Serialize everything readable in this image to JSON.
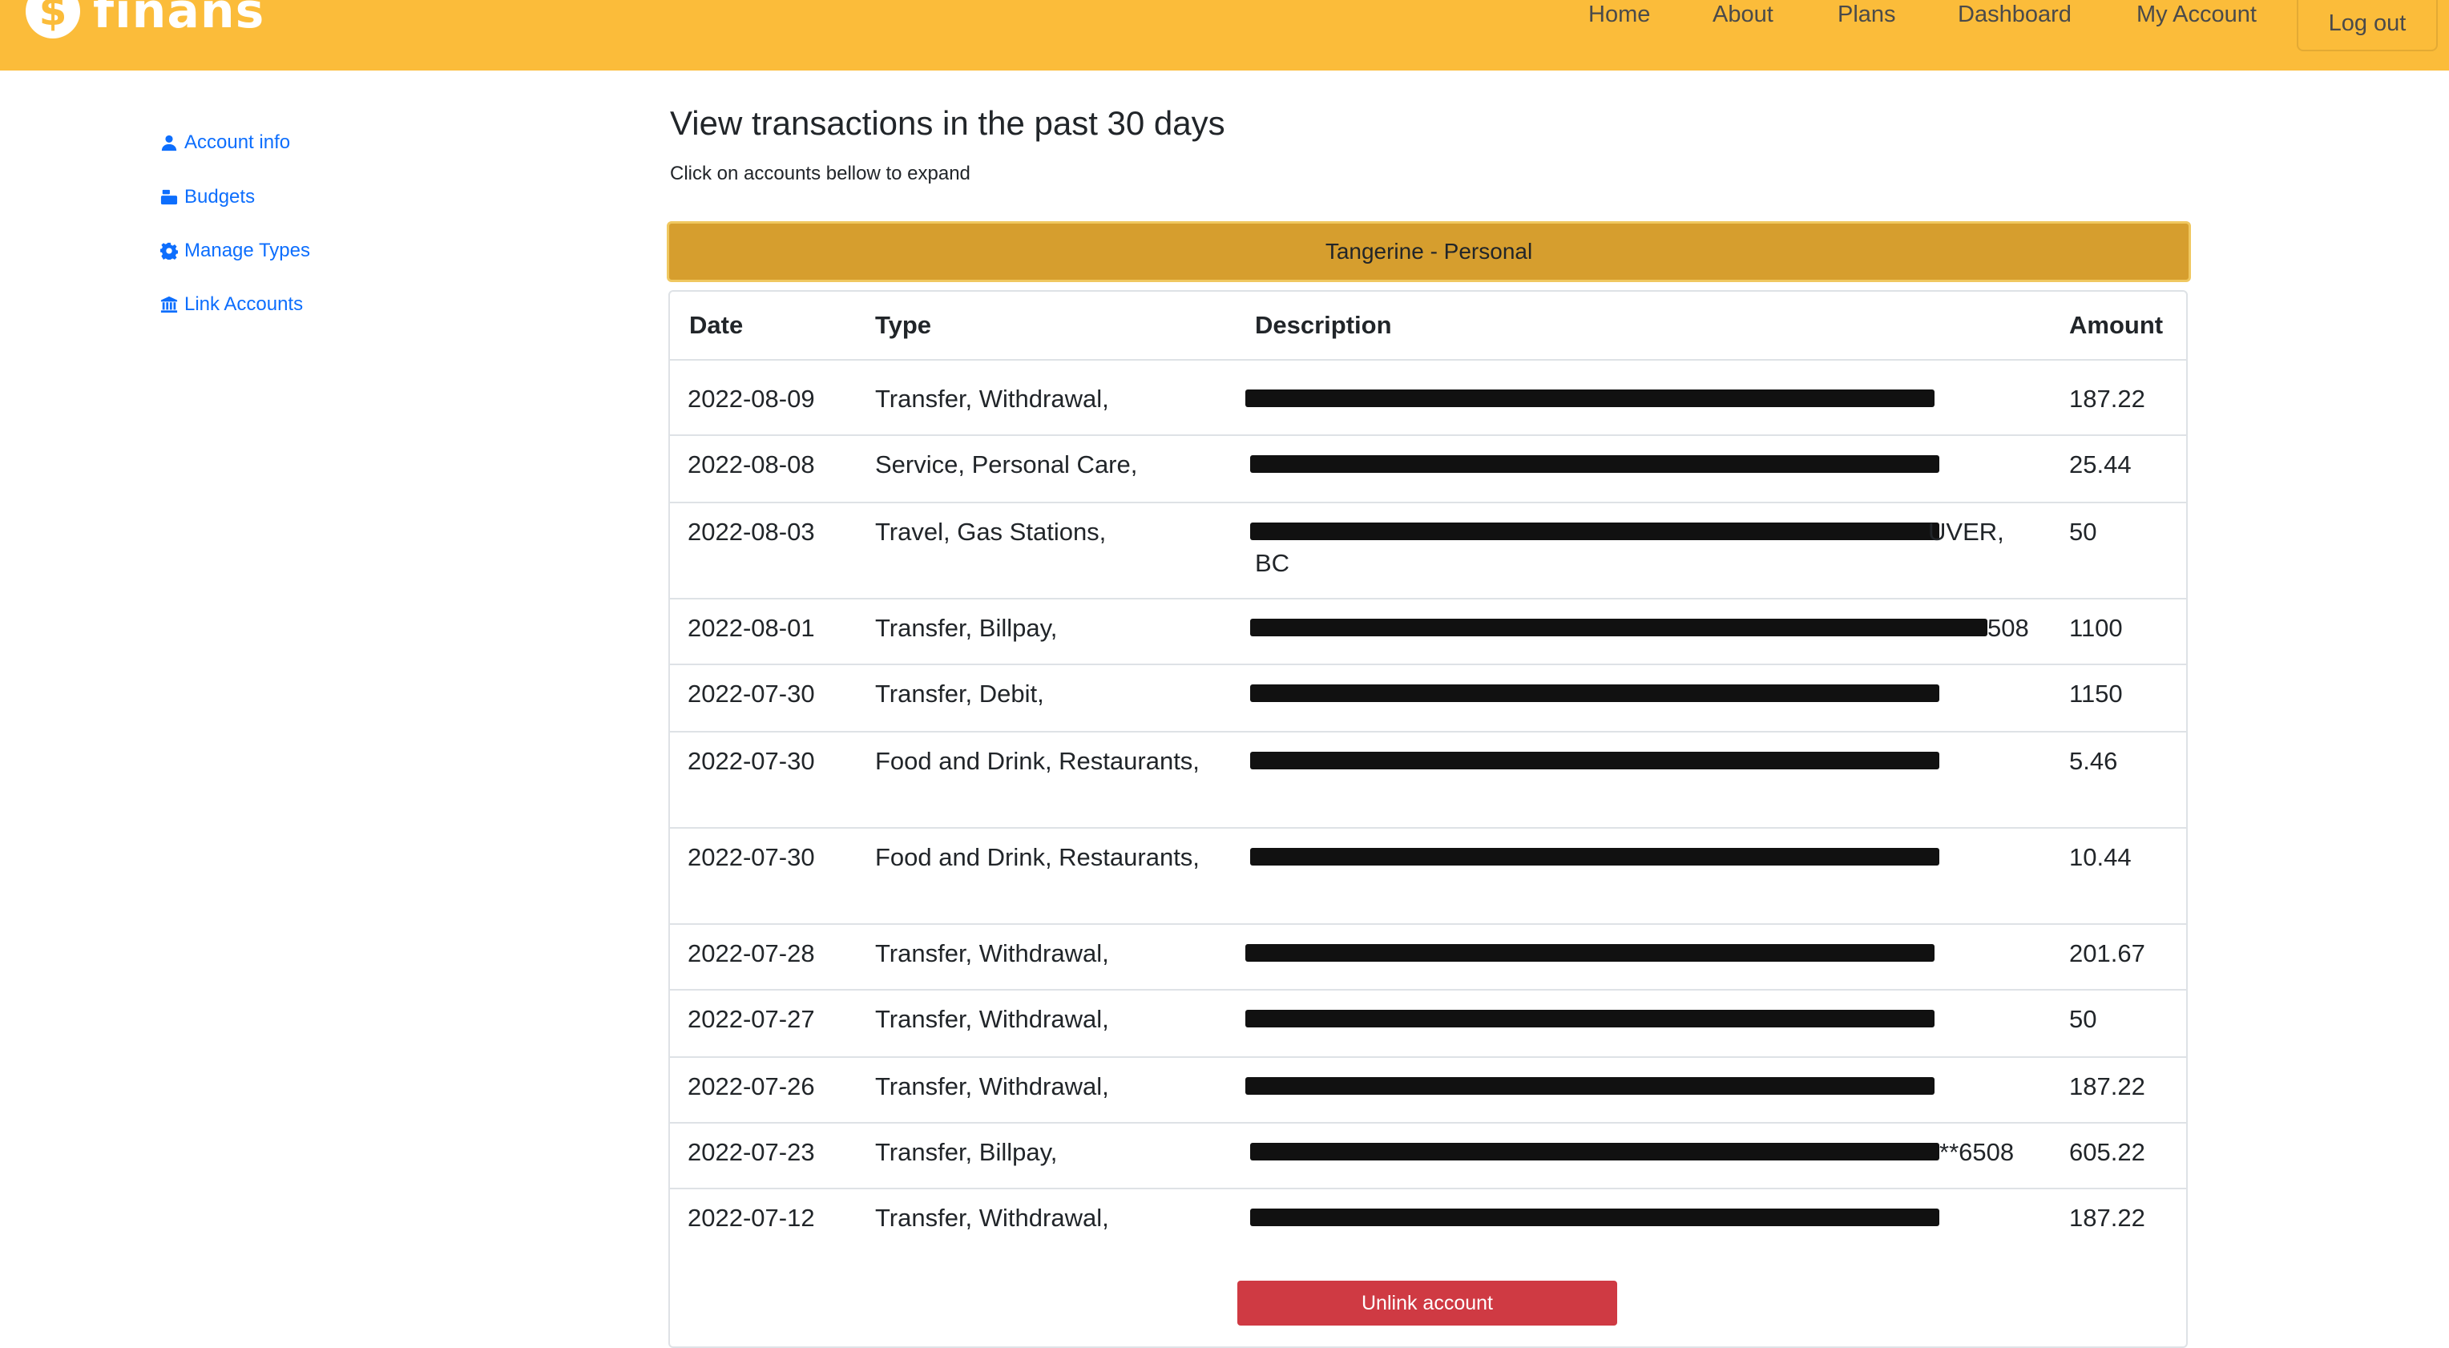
{
  "brand": {
    "logo_symbol": "$",
    "name": "finans",
    "color": "#fbbc3a"
  },
  "nav": {
    "home": "Home",
    "about": "About",
    "plans": "Plans",
    "dashboard": "Dashboard",
    "my_account": "My Account",
    "logout": "Log out"
  },
  "sidebar": {
    "items": [
      {
        "label": "Account info",
        "icon": "user-icon"
      },
      {
        "label": "Budgets",
        "icon": "cash-register-icon"
      },
      {
        "label": "Manage Types",
        "icon": "gear-icon"
      },
      {
        "label": "Link Accounts",
        "icon": "bank-icon"
      }
    ]
  },
  "main": {
    "title": "View transactions in the past 30 days",
    "subtitle": "Click on accounts bellow to expand",
    "account_name": "Tangerine - Personal",
    "columns": {
      "date": "Date",
      "type": "Type",
      "description": "Description",
      "amount": "Amount"
    },
    "rows": [
      {
        "date": "2022-08-09",
        "type": "Transfer, Withdrawal,",
        "desc_suffix": "",
        "amount": "187.22"
      },
      {
        "date": "2022-08-08",
        "type": "Service, Personal Care,",
        "desc_suffix": "",
        "amount": "25.44"
      },
      {
        "date": "2022-08-03",
        "type": "Travel, Gas Stations,",
        "desc_suffix": "UVER,",
        "desc_line2": "BC",
        "amount": "50"
      },
      {
        "date": "2022-08-01",
        "type": "Transfer, Billpay,",
        "desc_suffix": "508",
        "amount": "1100"
      },
      {
        "date": "2022-07-30",
        "type": "Transfer, Debit,",
        "desc_suffix": "",
        "amount": "1150"
      },
      {
        "date": "2022-07-30",
        "type": "Food and Drink, Restaurants,",
        "desc_suffix": "",
        "amount": "5.46"
      },
      {
        "date": "2022-07-30",
        "type": "Food and Drink, Restaurants,",
        "desc_suffix": "",
        "amount": "10.44"
      },
      {
        "date": "2022-07-28",
        "type": "Transfer, Withdrawal,",
        "desc_suffix": "",
        "amount": "201.67"
      },
      {
        "date": "2022-07-27",
        "type": "Transfer, Withdrawal,",
        "desc_suffix": "",
        "amount": "50"
      },
      {
        "date": "2022-07-26",
        "type": "Transfer, Withdrawal,",
        "desc_suffix": "",
        "amount": "187.22"
      },
      {
        "date": "2022-07-23",
        "type": "Transfer, Billpay,",
        "desc_suffix": "**6508",
        "amount": "605.22"
      },
      {
        "date": "2022-07-12",
        "type": "Transfer, Withdrawal,",
        "desc_suffix": "",
        "amount": "187.22"
      }
    ],
    "unlink_label": "Unlink account"
  }
}
